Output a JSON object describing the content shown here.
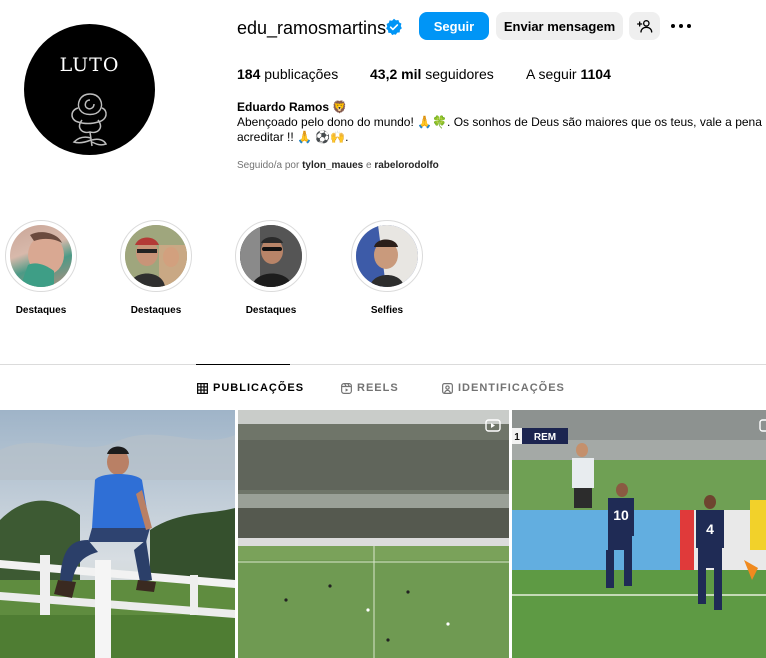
{
  "profile": {
    "avatar_text": "LUTO",
    "username": "edu_ramosmartins",
    "follow_label": "Seguir",
    "message_label": "Enviar mensagem",
    "stats": {
      "posts_count": "184",
      "posts_label": "publicações",
      "followers_count": "43,2 mil",
      "followers_label": "seguidores",
      "following_label": "A seguir",
      "following_count": "1104"
    },
    "full_name": "Eduardo Ramos 🦁",
    "bio_line1": "Abençoado pelo dono do mundo! 🙏🍀. Os sonhos de Deus são maiores que os teus, vale a pena",
    "bio_line2": "acreditar !! 🙏 ⚽🙌.",
    "followed_by_prefix": "Seguido/a por",
    "followed_by_user1": "tylon_maues",
    "followed_by_and": "e",
    "followed_by_user2": "rabelorodolfo"
  },
  "highlights": [
    {
      "label": "Destaques"
    },
    {
      "label": "Destaques"
    },
    {
      "label": "Destaques"
    },
    {
      "label": "Selfies"
    }
  ],
  "tabs": [
    {
      "label": "PUBLICAÇÕES",
      "icon": "grid-icon"
    },
    {
      "label": "REELS",
      "icon": "reels-icon"
    },
    {
      "label": "IDENTIFICAÇÕES",
      "icon": "tagged-icon"
    }
  ],
  "posts": {
    "post3_score_team": "REM",
    "post3_score_num": "1",
    "post3_jersey1": "10",
    "post3_jersey2": "4"
  },
  "colors": {
    "accent": "#0095f6",
    "verified": "#0095f6",
    "button_gray": "#efefef",
    "muted_text": "#737373"
  }
}
